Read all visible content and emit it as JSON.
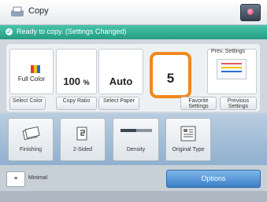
{
  "header": {
    "title": "Copy",
    "home_icon": "home-icon"
  },
  "status": {
    "message": "Ready to copy. (Settings Changed)"
  },
  "settings": {
    "color_value": "Full Color",
    "ratio_value": "100",
    "ratio_unit": "%",
    "paper_value": "Auto",
    "copies": "5",
    "preview_label": "Prev. Settings"
  },
  "buttons": {
    "select_color": "Select Color",
    "copy_ratio": "Copy Ratio",
    "select_paper": "Select Paper",
    "favorite_settings": "Favorite Settings",
    "previous_settings": "Previous Settings"
  },
  "functions": [
    {
      "label": "Finishing"
    },
    {
      "label": "2-Sided"
    },
    {
      "label": "Density"
    },
    {
      "label": "Original Type"
    }
  ],
  "bottom": {
    "minimal_label": "Minimal",
    "options_label": "Options"
  },
  "colors": {
    "accent_orange": "#f0891e",
    "status_green": "#249c83",
    "options_blue": "#3b7fc8"
  }
}
